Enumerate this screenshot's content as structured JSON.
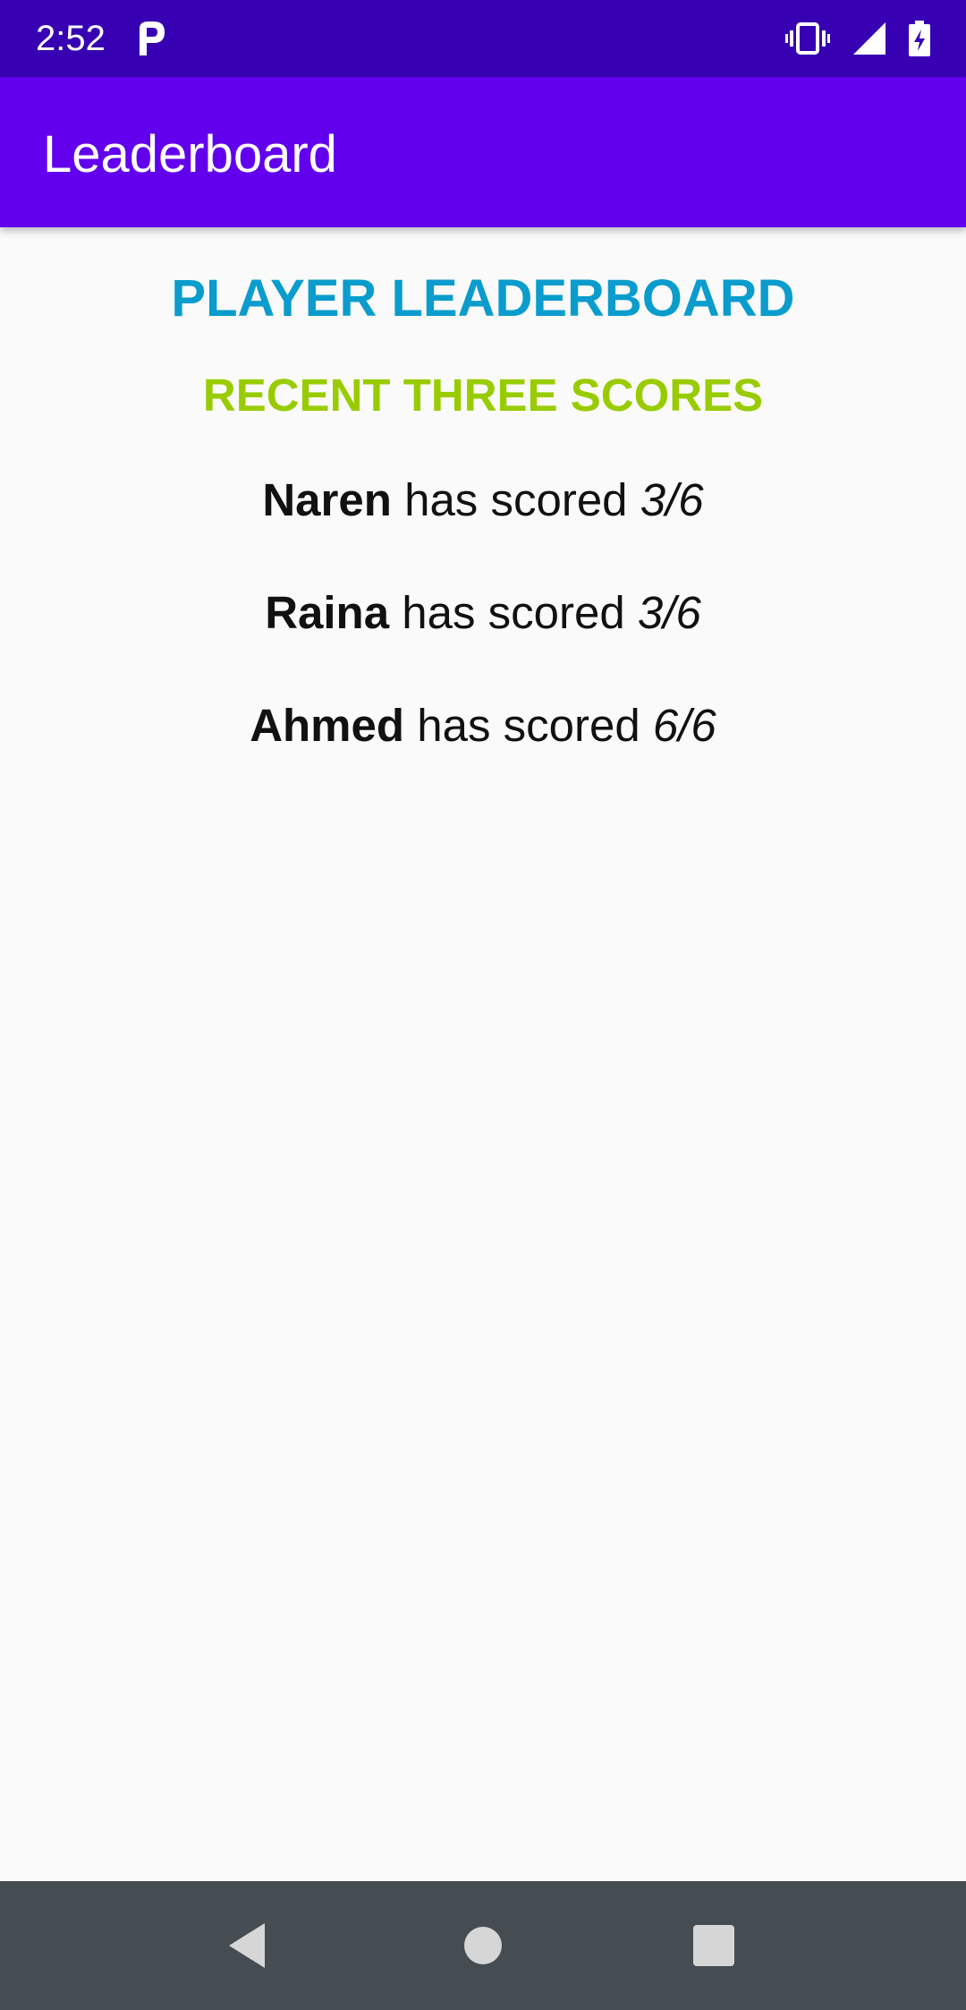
{
  "status_bar": {
    "time": "2:52",
    "icons": [
      "p-app-icon",
      "vibrate-icon",
      "signal-icon",
      "battery-charging-icon"
    ],
    "background": "#3700b3"
  },
  "app_bar": {
    "title": "Leaderboard",
    "background": "#6200ee"
  },
  "main": {
    "heading": "PLAYER LEADERBOARD",
    "heading_color": "#0a9ccc",
    "subheading": "RECENT THREE SCORES",
    "subheading_color": "#99cc00",
    "score_phrase": "has scored",
    "scores": [
      {
        "name": "Naren",
        "score": "3/6"
      },
      {
        "name": "Raina",
        "score": "3/6"
      },
      {
        "name": "Ahmed",
        "score": "6/6"
      }
    ]
  },
  "nav_bar": {
    "buttons": [
      "back-icon",
      "home-icon",
      "recents-icon"
    ],
    "background": "#454c52"
  }
}
